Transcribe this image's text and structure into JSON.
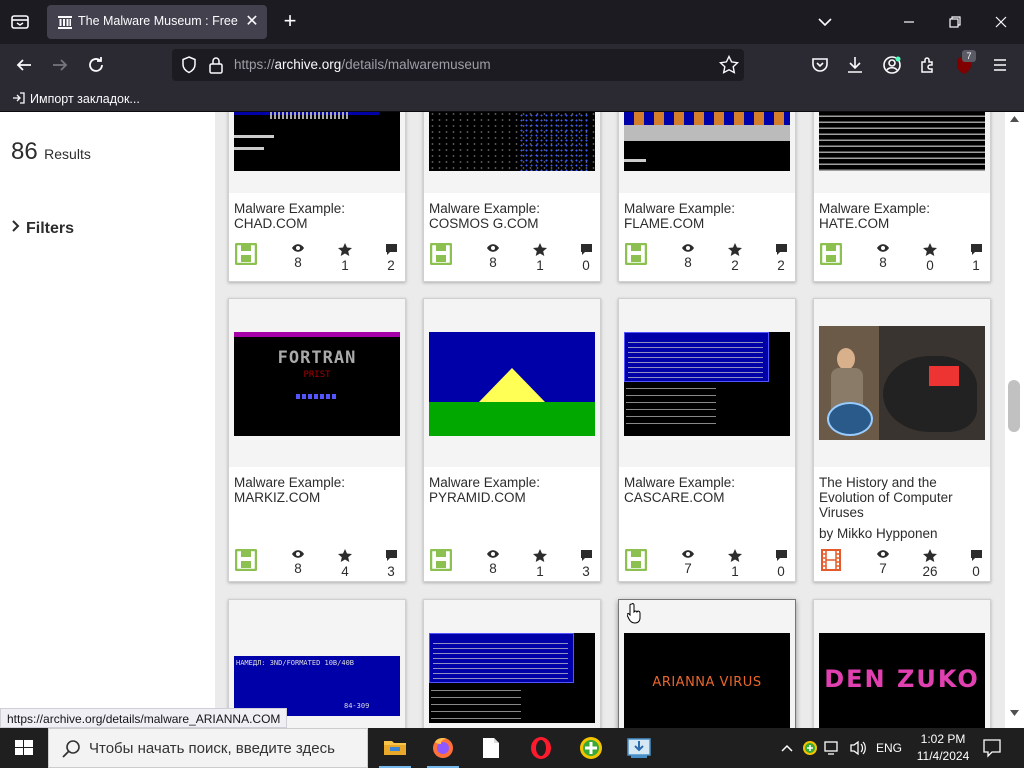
{
  "browser": {
    "tab_title": "The Malware Museum : Free Sc",
    "url_prefix": "https://",
    "url_host": "archive.org",
    "url_path": "/details/malwaremuseum",
    "extensions_badge": "7",
    "bookmark_item": "Импорт закладок..."
  },
  "sidebar": {
    "results_count": "86",
    "results_label": "Results",
    "filters_label": "Filters"
  },
  "cards": [
    {
      "title": "Malware Example: CHAD.COM",
      "views": "8",
      "favs": "1",
      "reviews": "2"
    },
    {
      "title": "Malware Example: COSMOS G.COM",
      "views": "8",
      "favs": "1",
      "reviews": "0"
    },
    {
      "title": "Malware Example: FLAME.COM",
      "views": "8",
      "favs": "2",
      "reviews": "2"
    },
    {
      "title": "Malware Example: HATE.COM",
      "views": "8",
      "favs": "0",
      "reviews": "1"
    },
    {
      "title": "Malware Example: MARKIZ.COM",
      "views": "8",
      "favs": "4",
      "reviews": "3"
    },
    {
      "title": "Malware Example: PYRAMID.COM",
      "views": "8",
      "favs": "1",
      "reviews": "3"
    },
    {
      "title": "Malware Example: CASCARE.COM",
      "views": "7",
      "favs": "1",
      "reviews": "0"
    },
    {
      "title": "The History and the Evolution of Computer Viruses",
      "byline": "by Mikko Hypponen",
      "views": "7",
      "favs": "26",
      "reviews": "0"
    }
  ],
  "thumb_text": {
    "arianna": "ARIANNA VIRUS",
    "denzuko": "DEN ZUKO",
    "markiz": "FORTRAN",
    "markiz_sub": "PRIST",
    "bottom1": "НАМЕДЛ: 3ND/FORMATED 10B/40B",
    "bottom1_foot": "84-309"
  },
  "status_url": "https://archive.org/details/malware_ARIANNA.COM",
  "taskbar": {
    "search_placeholder": "Чтобы начать поиск, введите здесь",
    "lang": "ENG",
    "time": "1:02 PM",
    "date": "11/4/2024"
  },
  "colors": {
    "tabbar_bg": "#1c1b22",
    "navbar_bg": "#2b2a33",
    "software_icon": "#8cc152",
    "movie_icon": "#e55a2b"
  }
}
